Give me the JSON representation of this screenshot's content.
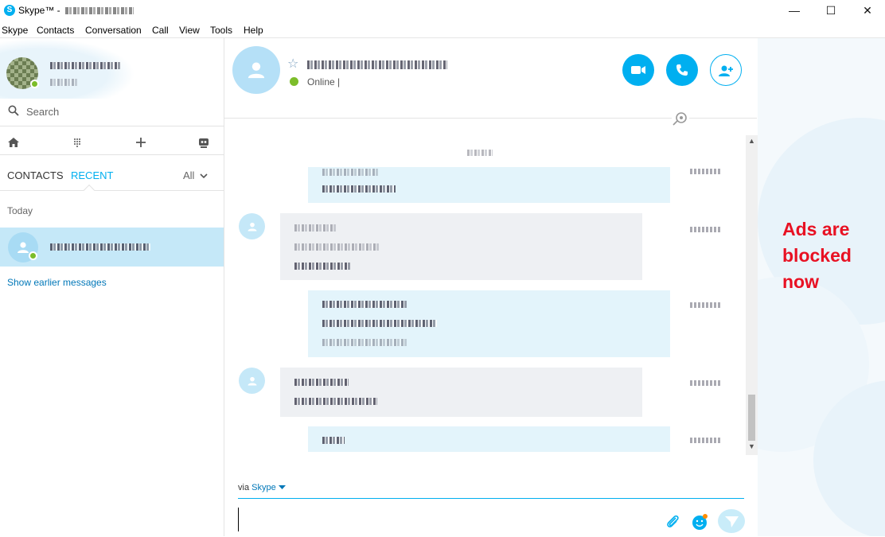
{
  "window": {
    "app_title": "Skype™ - ",
    "logo_letter": "S",
    "minimize_glyph": "—",
    "maximize_glyph": "☐",
    "close_glyph": "✕"
  },
  "menu": {
    "items": [
      "Skype",
      "Contacts",
      "Conversation",
      "Call",
      "View",
      "Tools",
      "Help"
    ]
  },
  "sidebar": {
    "search_placeholder": "Search",
    "tabs": [
      "CONTACTS",
      "RECENT"
    ],
    "active_tab": "RECENT",
    "filter_label": "All",
    "section_label": "Today",
    "show_earlier": "Show earlier messages"
  },
  "conversation": {
    "status": "Online",
    "status_separator": "|",
    "via_label": "via",
    "via_service": "Skype",
    "accent_color": "#00aff0",
    "online_color": "#7cbd2a"
  },
  "right_pane": {
    "message": "Ads are blocked now",
    "message_color": "#e81123"
  }
}
